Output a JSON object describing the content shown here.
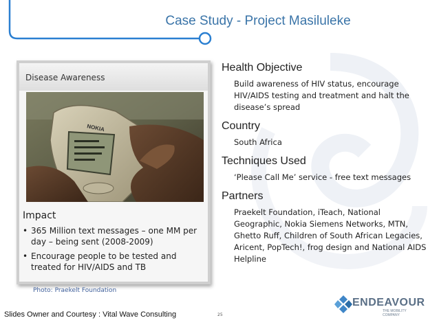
{
  "slide": {
    "title": "Case Study - Project Masiluleke",
    "panel": {
      "label": "Disease Awareness",
      "impact_title": "Impact",
      "impact_bullets": [
        "365 Million text messages – one MM per day – being sent (2008-2009)",
        "Encourage people to be tested and treated for HIV/AIDS and TB"
      ],
      "bullet_char": "•",
      "photo_brand": "NOKIA"
    },
    "photo_credit": "Photo: Praekelt Foundation",
    "sections": [
      {
        "heading": "Health Objective",
        "body": "Build awareness of HIV status, encourage HIV/AIDS testing and treatment and halt the disease’s spread"
      },
      {
        "heading": "Country",
        "body": "South Africa"
      },
      {
        "heading": "Techniques Used",
        "body": "‘Please Call Me’ service - free text messages"
      },
      {
        "heading": "Partners",
        "body": "Praekelt Foundation, iTeach, National Geographic, Nokia Siemens Networks, MTN, Ghetto Ruff, Children of South African Legacies, Aricent, PopTech!, frog design and National AIDS Helpline"
      }
    ],
    "footer": "Slides Owner and Courtesy : Vital Wave Consulting",
    "page_number": "25",
    "logo": {
      "word": "ENDEAVOUR",
      "tagline": "THE MOBILITY COMPANY",
      "icon": "endeavour-logo-icon"
    },
    "colors": {
      "title": "#3a74a8",
      "accent_line": "#2a7fd1",
      "logo_word": "#5a6f86",
      "credit": "#3f5f9a"
    }
  }
}
